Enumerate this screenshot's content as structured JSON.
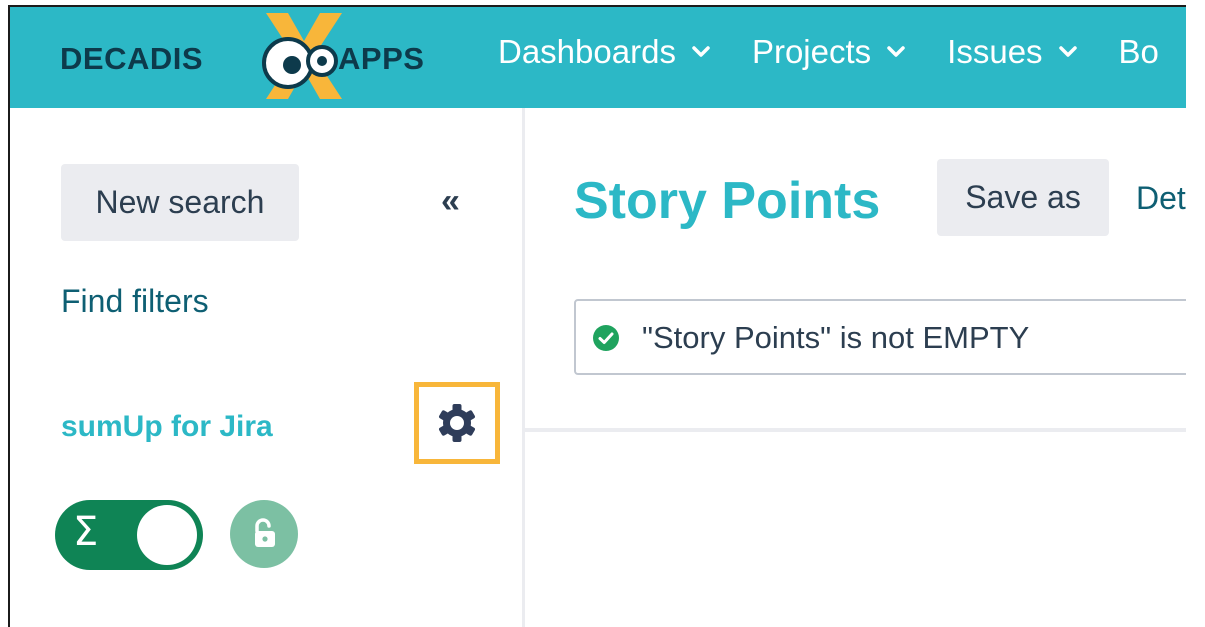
{
  "header": {
    "logo": {
      "left_text": "DECADIS",
      "right_text": "APPS"
    },
    "nav": [
      {
        "label": "Dashboards"
      },
      {
        "label": "Projects"
      },
      {
        "label": "Issues"
      },
      {
        "label": "Bo"
      }
    ]
  },
  "sidebar": {
    "new_search_label": "New search",
    "collapse_icon": "«",
    "find_filters_label": "Find filters",
    "sumup_title": "sumUp for Jira",
    "toggle_symbol": "Σ"
  },
  "main": {
    "title": "Story Points",
    "save_as_label": "Save as",
    "details_label": "Det",
    "query_text": "\"Story Points\" is not EMPTY"
  },
  "colors": {
    "header_bg": "#2cb8c6",
    "accent": "#2cb8c6",
    "highlight_border": "#f8b63a",
    "toggle_on": "#0f8455",
    "lock_bg": "#7cc0a3",
    "success": "#1fa35e"
  }
}
